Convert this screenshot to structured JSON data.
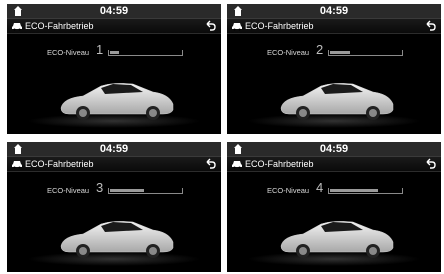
{
  "screens": [
    {
      "clock": "04:59",
      "title": "ECO-Fahrbetrieb",
      "eco_label": "ECO-Niveau",
      "eco_level": "1",
      "fill_fraction": 0.12
    },
    {
      "clock": "04:59",
      "title": "ECO-Fahrbetrieb",
      "eco_label": "ECO-Niveau",
      "eco_level": "2",
      "fill_fraction": 0.27
    },
    {
      "clock": "04:59",
      "title": "ECO-Fahrbetrieb",
      "eco_label": "ECO-Niveau",
      "eco_level": "3",
      "fill_fraction": 0.47
    },
    {
      "clock": "04:59",
      "title": "ECO-Fahrbetrieb",
      "eco_label": "ECO-Niveau",
      "eco_level": "4",
      "fill_fraction": 0.66
    }
  ],
  "colors": {
    "panel_bg": "#000000",
    "statusbar_bg": "#2a2a2a",
    "text": "#ffffff",
    "bar": "#9a9a9a"
  },
  "icons": {
    "home": "home-icon",
    "car": "car-icon",
    "back": "back-icon"
  }
}
